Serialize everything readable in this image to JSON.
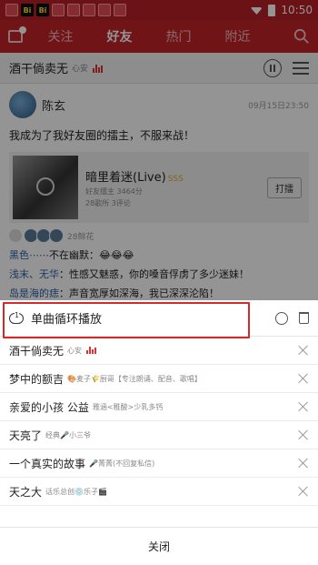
{
  "status_bar": {
    "time": "10:50",
    "badge_text": "Bi"
  },
  "nav": {
    "tabs": [
      "关注",
      "好友",
      "热门",
      "附近"
    ],
    "active_tab": "好友"
  },
  "now_playing": {
    "title": "酒干倘卖无",
    "artist": "心安"
  },
  "post": {
    "username": "陈玄",
    "date": "09月15日23:50",
    "text": "我成为了我好友圈的擂主，不服来战！",
    "song": {
      "title": "暗里着迷(Live)",
      "meta1": "好友擂主 3464分",
      "meta2": "28歌所 3评论"
    },
    "challenge_label": "打擂",
    "flowers": "28鲜花",
    "comments": [
      {
        "name": "黑色⋯⋯",
        "text": "不在幽默：😂😂😂"
      },
      {
        "name": "浅末、无华",
        "text": "：性感又魅惑，你的嗓音俘虏了多少迷妹！"
      },
      {
        "name": "岛是海的痣",
        "text": "：声音宽厚如深海，我已深深沦陷！"
      }
    ]
  },
  "sheet": {
    "mode_label": "单曲循环播放",
    "close_label": "关闭",
    "queue": [
      {
        "title": "酒干倘卖无",
        "artist": "心安",
        "playing": true
      },
      {
        "title": "梦中的额吉",
        "artist": "🎨麦子🌾厨哥【专注朗诵、配音、歌唱】"
      },
      {
        "title": "亲爱的小孩 公益",
        "artist": "雅涵<稚酸>少乳多钙"
      },
      {
        "title": "天亮了",
        "artist": "经典🎤小三爷"
      },
      {
        "title": "一个真实的故事",
        "artist": "🎤菁菁(不回复私信)"
      },
      {
        "title": "天之大",
        "artist": "话乐总创💿乐子🎬"
      }
    ]
  },
  "colors": {
    "brand_red": "#c12328",
    "highlight": "#d32a2a"
  }
}
